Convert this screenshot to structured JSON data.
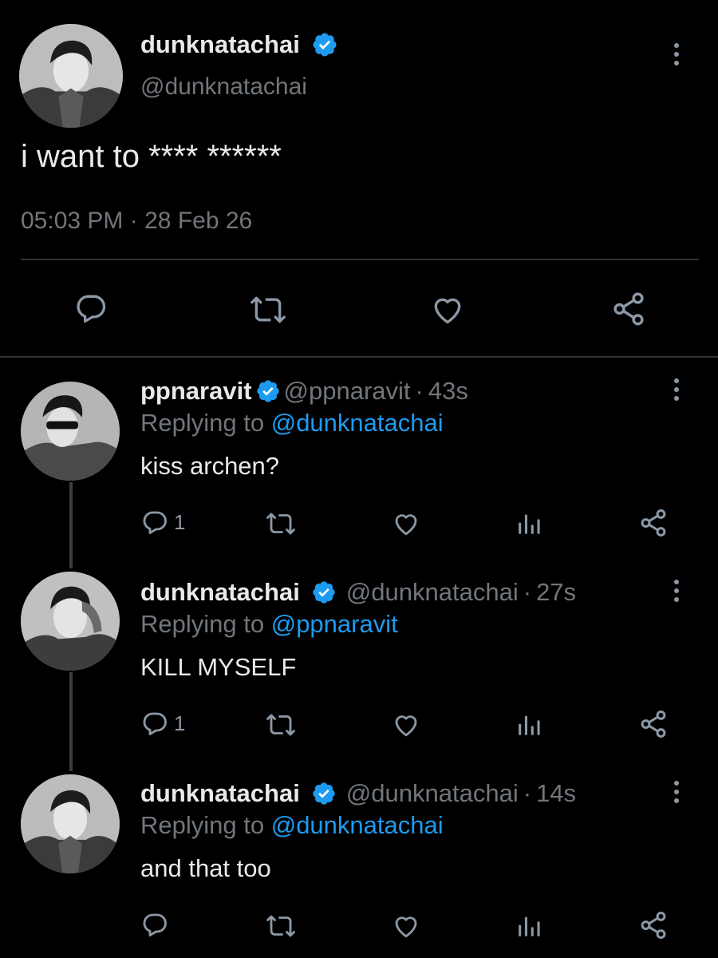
{
  "main_tweet": {
    "name": "dunknatachai",
    "handle": "@dunknatachai",
    "text": "i want to **** ******",
    "time": "05:03 PM",
    "date": "28 Feb 26",
    "separator": "·"
  },
  "replies": [
    {
      "name": "ppnaravit",
      "handle": "@ppnaravit",
      "time": "43s",
      "replying_prefix": "Replying to",
      "replying_to": "@dunknatachai",
      "text": "kiss archen?",
      "reply_count": "1"
    },
    {
      "name": "dunknatachai",
      "handle": "@dunknatachai",
      "time": "27s",
      "replying_prefix": "Replying to",
      "replying_to": "@ppnaravit",
      "text": "KILL MYSELF",
      "reply_count": "1"
    },
    {
      "name": "dunknatachai",
      "handle": "@dunknatachai",
      "time": "14s",
      "replying_prefix": "Replying to",
      "replying_to": "@dunknatachai",
      "text": "and that too",
      "reply_count": ""
    }
  ],
  "colors": {
    "background": "#000000",
    "text": "#e7e9ea",
    "secondary": "#71767b",
    "accent_blue": "#1d9bf0",
    "icon": "#8b98a5",
    "divider": "#2f3336"
  },
  "icons": [
    "reply-icon",
    "retweet-icon",
    "like-icon",
    "share-icon",
    "analytics-icon",
    "verified-badge-icon",
    "more-options-icon"
  ]
}
